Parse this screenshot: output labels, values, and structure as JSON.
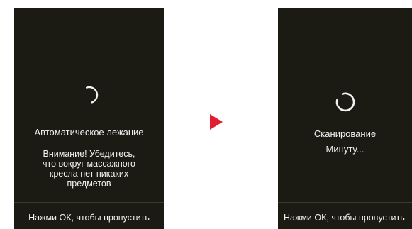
{
  "colors": {
    "screen_background": "#1b1b14",
    "text": "#f2f2f2",
    "arrow": "#e01e2f"
  },
  "left_screen": {
    "spinner_icon": "loading-spinner-icon",
    "title": "Автоматическое лежание",
    "message": "Внимание! Убедитесь,\nчто вокруг массажного\nкресла нет никаких\nпредметов",
    "footer": "Нажми ОК, чтобы пропустить"
  },
  "transition": {
    "icon": "arrow-right-icon"
  },
  "right_screen": {
    "spinner_icon": "loading-spinner-icon",
    "title": "Сканирование",
    "message": "Минуту...",
    "footer": "Нажми ОК, чтобы пропустить"
  }
}
